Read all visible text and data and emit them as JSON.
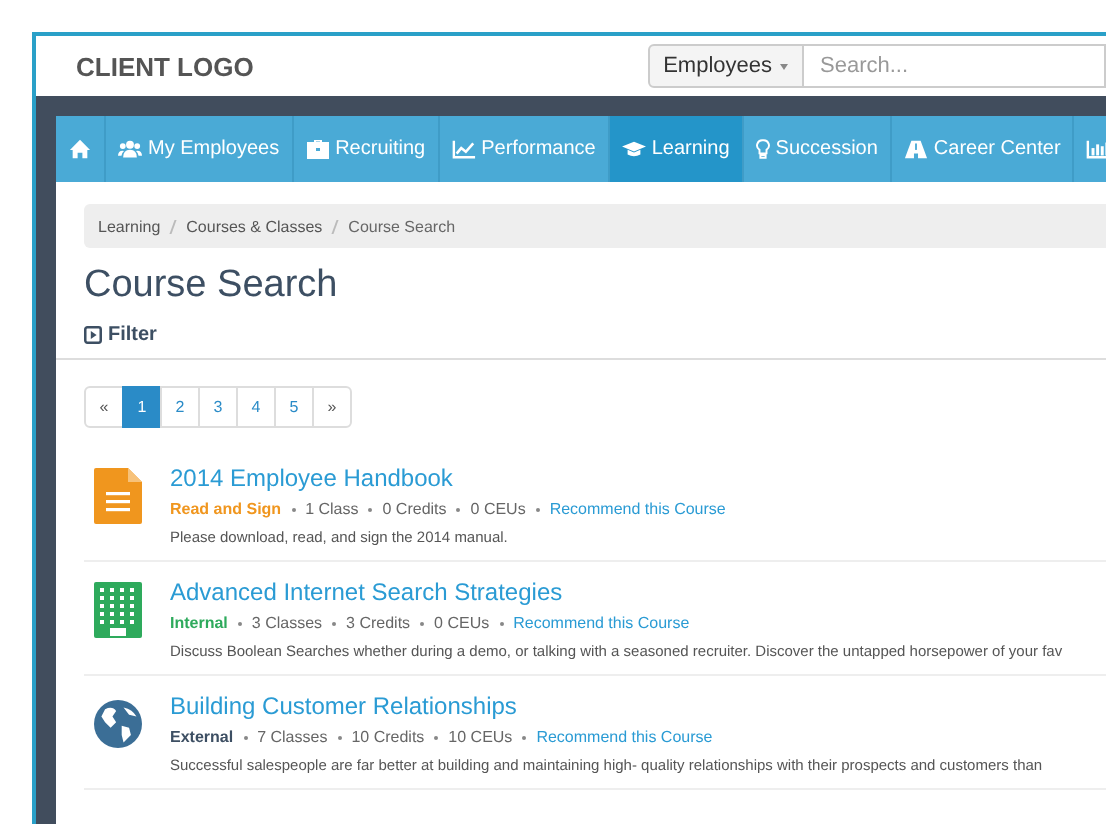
{
  "header": {
    "logo": "CLIENT LOGO",
    "search_scope": "Employees",
    "search": {
      "placeholder": "Search..."
    }
  },
  "nav": [
    {
      "kind": "home",
      "selected": false
    },
    {
      "kind": "users",
      "label": "My Employees",
      "selected": false
    },
    {
      "kind": "briefcase",
      "label": "Recruiting",
      "selected": false
    },
    {
      "kind": "chart",
      "label": "Performance",
      "selected": false
    },
    {
      "kind": "cap",
      "label": "Learning",
      "selected": true
    },
    {
      "kind": "bulb",
      "label": "Succession",
      "selected": false
    },
    {
      "kind": "road",
      "label": "Career Center",
      "selected": false
    },
    {
      "kind": "bars",
      "selected": false
    }
  ],
  "breadcrumb": [
    "Learning",
    "Courses & Classes",
    "Course Search"
  ],
  "page_title": "Course Search",
  "filter": "Filter",
  "pagination": [
    {
      "label": "«",
      "selected": false
    },
    {
      "label": "1",
      "selected": true
    },
    {
      "label": "2",
      "selected": false
    },
    {
      "label": "3",
      "selected": false
    },
    {
      "label": "4",
      "selected": false
    },
    {
      "label": "5",
      "selected": false
    },
    {
      "label": "»",
      "selected": false
    }
  ],
  "courses": [
    {
      "kind": "document",
      "title": "2014 Employee Handbook",
      "type": "Read and Sign",
      "color": "#f0961e",
      "meta": [
        "1 Class",
        "0 Credits",
        "0 CEUs"
      ],
      "link": "Recommend this Course",
      "description": "Please download, read, and sign the 2014 manual."
    },
    {
      "kind": "building",
      "title": "Advanced Internet Search Strategies",
      "type": "Internal",
      "color": "#2eaa5c",
      "meta": [
        "3 Classes",
        "3 Credits",
        "0 CEUs"
      ],
      "link": "Recommend this Course",
      "description": "Discuss Boolean Searches whether during a demo, or talking with a seasoned recruiter. Discover the untapped horsepower of your fav"
    },
    {
      "kind": "globe",
      "title": "Building Customer Relationships",
      "type": "External",
      "color": "#3d4f63",
      "meta": [
        "7 Classes",
        "10 Credits",
        "10 CEUs"
      ],
      "link": "Recommend this Course",
      "description": "Successful salespeople are far better at building and maintaining high- quality relationships with their prospects and customers than"
    }
  ]
}
